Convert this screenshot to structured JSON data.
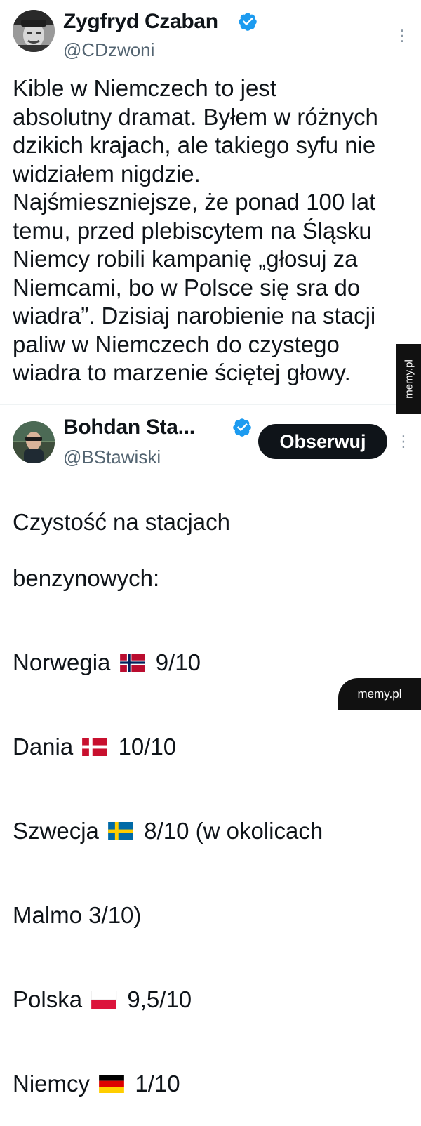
{
  "tweet1": {
    "display_name": "Zygfryd Czaban",
    "handle": "@CDzwoni",
    "body": "Kible w Niemczech to jest\nabsolutny dramat. Byłem w różnych\ndzikich krajach, ale takiego syfu nie\nwidziałem nigdzie.\nNajśmieszniejsze, że ponad 100 lat\ntemu, przed plebiscytem na Śląsku\nNiemcy robili kampanię „głosuj za\nNiemcami, bo w Polsce się sra do\nwiadra”. Dzisiaj narobienie na stacji\npaliw w Niemczech do czystego\nwiadra to marzenie ściętej głowy."
  },
  "tweet2": {
    "display_name": "Bohdan Sta...",
    "handle": "@BStawiski",
    "follow_label": "Obserwuj",
    "intro_line1": "Czystość na stacjach",
    "intro_line2": "benzynowych:",
    "ratings": [
      {
        "country": "Norwegia",
        "flag": "norway-flag-icon",
        "score": "9/10"
      },
      {
        "country": "Dania",
        "flag": "denmark-flag-icon",
        "score": "10/10"
      },
      {
        "country": "Szwecja",
        "flag": "sweden-flag-icon",
        "score": "8/10 (w okolicach"
      },
      {
        "country": "Polska",
        "flag": "poland-flag-icon",
        "score": "9,5/10"
      },
      {
        "country": "Niemcy",
        "flag": "germany-flag-icon",
        "score": "1/10"
      }
    ],
    "sweden_continuation": "Malmo 3/10)"
  },
  "watermarks": {
    "side": "memy.pl",
    "corner": "memy.pl"
  },
  "colors": {
    "verified_blue": "#1d9bf0",
    "text": "#0f1419",
    "secondary_text": "#536471",
    "follow_button_bg": "#0f1419"
  }
}
